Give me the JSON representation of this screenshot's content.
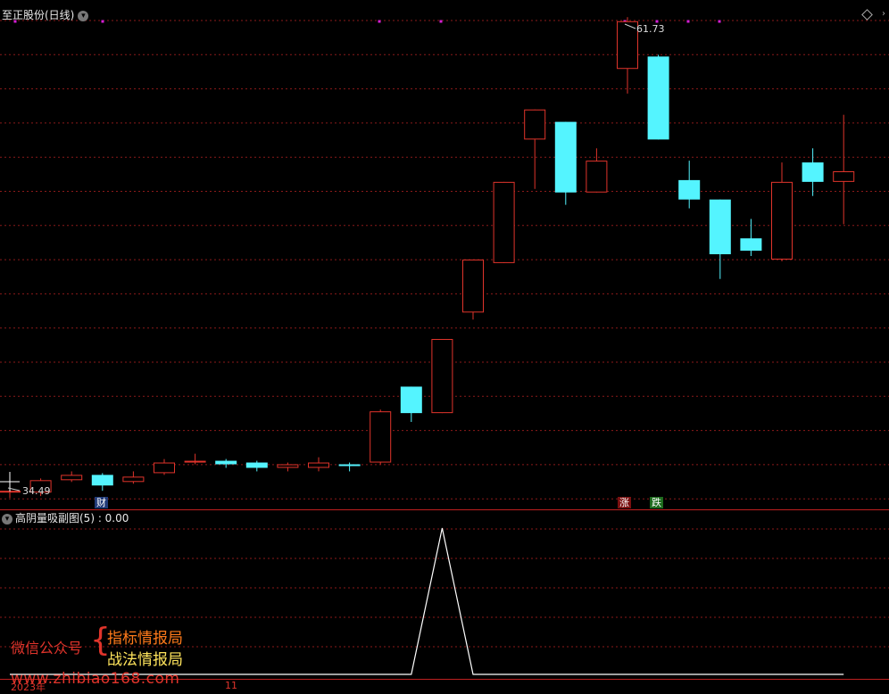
{
  "header": {
    "title": "至正股份(日线)"
  },
  "main_panel": {
    "high_label": "61.73",
    "low_label": "34.49"
  },
  "sub_panel": {
    "title": "高阴量吸副图(5) : 0.00"
  },
  "badges": {
    "cai": "财",
    "zhang": "涨",
    "die": "跌"
  },
  "watermark": {
    "left": "微信公众号",
    "brace": "{",
    "line1": "指标情报局",
    "line2": "战法情报局",
    "url": "www.zhibiao168.com"
  },
  "date_axis": {
    "left": "2023年",
    "mid": "11"
  },
  "colors": {
    "up": "#e0342b",
    "down": "#54f4ff",
    "grid": "#8b1a1a",
    "marker": "#d61ed6",
    "line": "#ffffff"
  },
  "chart_data": {
    "type": "candlestick",
    "candles": [
      {
        "o": 34.9,
        "h": 35.2,
        "l": 34.49,
        "c": 34.9
      },
      {
        "o": 34.8,
        "h": 35.6,
        "l": 34.6,
        "c": 35.5
      },
      {
        "o": 35.5,
        "h": 36.0,
        "l": 35.4,
        "c": 35.8
      },
      {
        "o": 35.8,
        "h": 35.9,
        "l": 34.9,
        "c": 35.2
      },
      {
        "o": 35.4,
        "h": 36.0,
        "l": 35.3,
        "c": 35.7
      },
      {
        "o": 35.9,
        "h": 36.7,
        "l": 35.8,
        "c": 36.5
      },
      {
        "o": 36.6,
        "h": 37.0,
        "l": 36.4,
        "c": 36.6
      },
      {
        "o": 36.6,
        "h": 36.7,
        "l": 36.2,
        "c": 36.4
      },
      {
        "o": 36.5,
        "h": 36.6,
        "l": 36.0,
        "c": 36.2
      },
      {
        "o": 36.2,
        "h": 36.5,
        "l": 36.0,
        "c": 36.4
      },
      {
        "o": 36.2,
        "h": 36.8,
        "l": 36.0,
        "c": 36.5
      },
      {
        "o": 36.4,
        "h": 36.5,
        "l": 36.0,
        "c": 36.3
      },
      {
        "o": 36.5,
        "h": 39.5,
        "l": 36.4,
        "c": 39.4
      },
      {
        "o": 40.8,
        "h": 40.8,
        "l": 38.8,
        "c": 39.3
      },
      {
        "o": 39.3,
        "h": 43.5,
        "l": 39.3,
        "c": 43.5
      },
      {
        "o": 45.0,
        "h": 46.4,
        "l": 44.6,
        "c": 48.0
      },
      {
        "o": 47.8,
        "h": 52.4,
        "l": 47.8,
        "c": 52.4
      },
      {
        "o": 54.8,
        "h": 56.5,
        "l": 52.0,
        "c": 56.5
      },
      {
        "o": 55.8,
        "h": 55.8,
        "l": 51.1,
        "c": 51.8
      },
      {
        "o": 51.8,
        "h": 54.3,
        "l": 51.8,
        "c": 53.6
      },
      {
        "o": 58.8,
        "h": 61.73,
        "l": 57.4,
        "c": 61.5
      },
      {
        "o": 59.5,
        "h": 59.6,
        "l": 54.8,
        "c": 54.8
      },
      {
        "o": 52.5,
        "h": 53.6,
        "l": 50.9,
        "c": 51.4
      },
      {
        "o": 51.4,
        "h": 51.4,
        "l": 46.9,
        "c": 48.3
      },
      {
        "o": 49.2,
        "h": 50.3,
        "l": 48.2,
        "c": 48.5
      },
      {
        "o": 48.0,
        "h": 53.5,
        "l": 47.9,
        "c": 52.4
      },
      {
        "o": 53.5,
        "h": 54.3,
        "l": 51.6,
        "c": 52.4
      },
      {
        "o": 52.4,
        "h": 56.2,
        "l": 50.0,
        "c": 53.0
      }
    ],
    "indicator": [
      0,
      0,
      0,
      0,
      0,
      0,
      0,
      0,
      0,
      0,
      0,
      0,
      0,
      0,
      1,
      0,
      0,
      0,
      0,
      0,
      0,
      0,
      0,
      0,
      0,
      0,
      0,
      0
    ],
    "ylim": [
      34.0,
      62.5
    ]
  }
}
